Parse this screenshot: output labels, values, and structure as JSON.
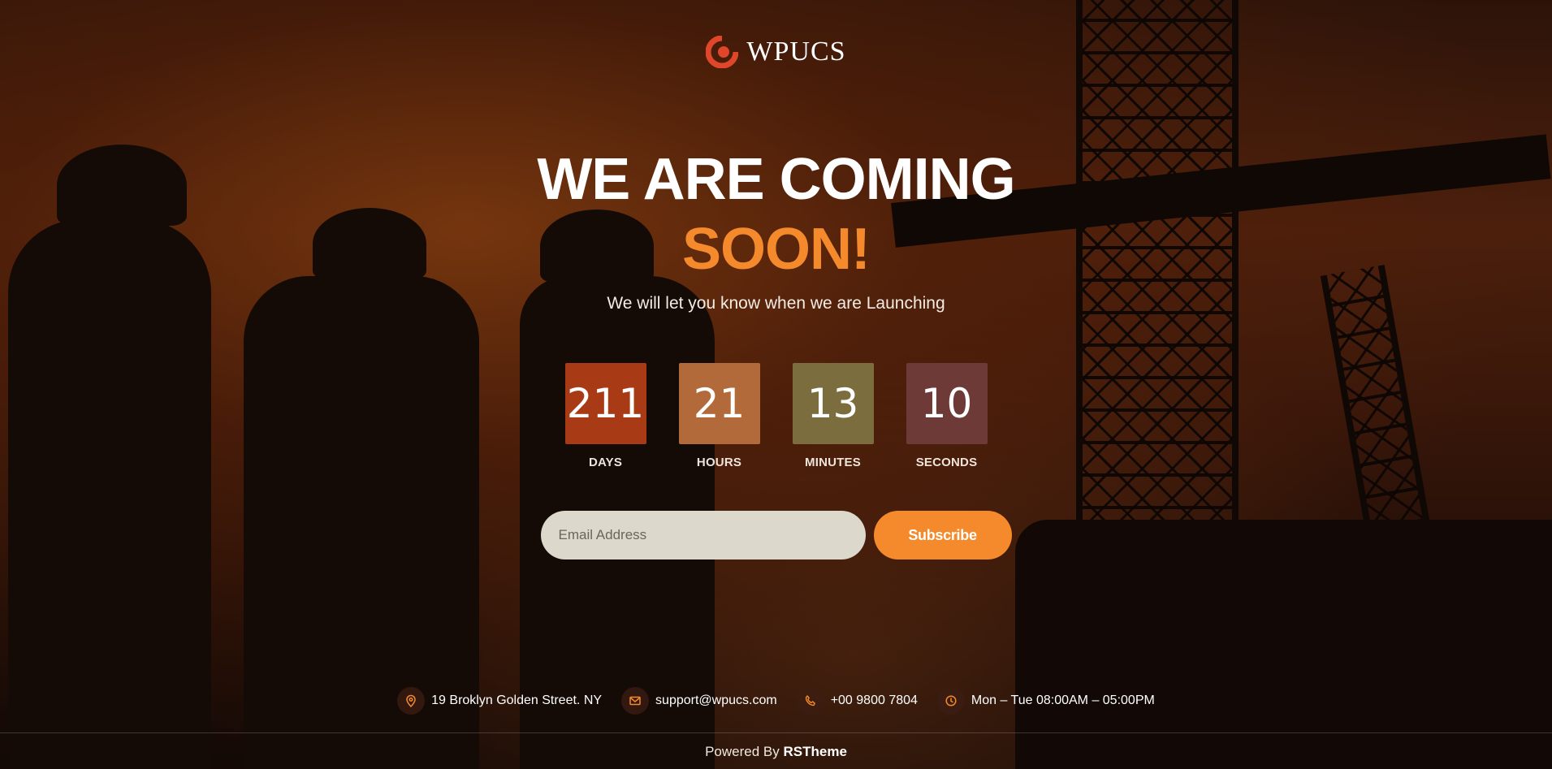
{
  "brand": {
    "name": "WPUCS",
    "accent_color": "#f58a2c"
  },
  "hero": {
    "headline_line1": "WE ARE COMING",
    "headline_line2": "SOON!",
    "tagline": "We will let you know when we are Launching"
  },
  "countdown": [
    {
      "value": "211",
      "label": "DAYS",
      "color": "#a83b16"
    },
    {
      "value": "21",
      "label": "HOURS",
      "color": "#b36a3a"
    },
    {
      "value": "13",
      "label": "MINUTES",
      "color": "#7b6d3e"
    },
    {
      "value": "10",
      "label": "SECONDS",
      "color": "#6e3a38"
    }
  ],
  "subscribe": {
    "email_placeholder": "Email Address",
    "email_value": "",
    "button_label": "Subscribe"
  },
  "contacts": [
    {
      "icon": "location-pin-icon",
      "text": "19 Broklyn Golden Street. NY"
    },
    {
      "icon": "mail-icon",
      "text": "support@wpucs.com"
    },
    {
      "icon": "phone-icon",
      "text": "+00 9800 7804"
    },
    {
      "icon": "clock-icon",
      "text": "Mon – Tue 08:00AM – 05:00PM"
    }
  ],
  "footer": {
    "prefix": "Powered By",
    "brand": "RSTheme"
  }
}
